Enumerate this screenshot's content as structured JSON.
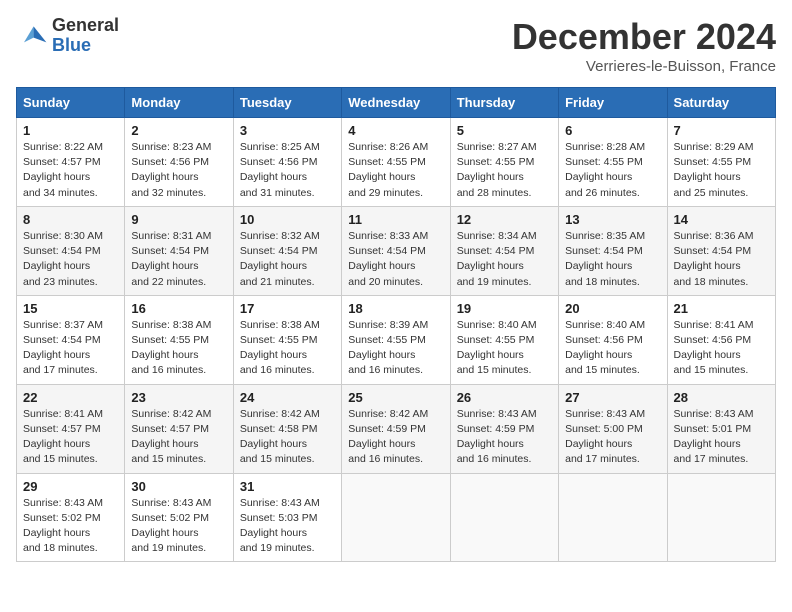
{
  "logo": {
    "general": "General",
    "blue": "Blue"
  },
  "header": {
    "month": "December 2024",
    "location": "Verrieres-le-Buisson, France"
  },
  "weekdays": [
    "Sunday",
    "Monday",
    "Tuesday",
    "Wednesday",
    "Thursday",
    "Friday",
    "Saturday"
  ],
  "weeks": [
    [
      {
        "day": "1",
        "sunrise": "8:22 AM",
        "sunset": "4:57 PM",
        "daylight": "8 hours and 34 minutes."
      },
      {
        "day": "2",
        "sunrise": "8:23 AM",
        "sunset": "4:56 PM",
        "daylight": "8 hours and 32 minutes."
      },
      {
        "day": "3",
        "sunrise": "8:25 AM",
        "sunset": "4:56 PM",
        "daylight": "8 hours and 31 minutes."
      },
      {
        "day": "4",
        "sunrise": "8:26 AM",
        "sunset": "4:55 PM",
        "daylight": "8 hours and 29 minutes."
      },
      {
        "day": "5",
        "sunrise": "8:27 AM",
        "sunset": "4:55 PM",
        "daylight": "8 hours and 28 minutes."
      },
      {
        "day": "6",
        "sunrise": "8:28 AM",
        "sunset": "4:55 PM",
        "daylight": "8 hours and 26 minutes."
      },
      {
        "day": "7",
        "sunrise": "8:29 AM",
        "sunset": "4:55 PM",
        "daylight": "8 hours and 25 minutes."
      }
    ],
    [
      {
        "day": "8",
        "sunrise": "8:30 AM",
        "sunset": "4:54 PM",
        "daylight": "8 hours and 23 minutes."
      },
      {
        "day": "9",
        "sunrise": "8:31 AM",
        "sunset": "4:54 PM",
        "daylight": "8 hours and 22 minutes."
      },
      {
        "day": "10",
        "sunrise": "8:32 AM",
        "sunset": "4:54 PM",
        "daylight": "8 hours and 21 minutes."
      },
      {
        "day": "11",
        "sunrise": "8:33 AM",
        "sunset": "4:54 PM",
        "daylight": "8 hours and 20 minutes."
      },
      {
        "day": "12",
        "sunrise": "8:34 AM",
        "sunset": "4:54 PM",
        "daylight": "8 hours and 19 minutes."
      },
      {
        "day": "13",
        "sunrise": "8:35 AM",
        "sunset": "4:54 PM",
        "daylight": "8 hours and 18 minutes."
      },
      {
        "day": "14",
        "sunrise": "8:36 AM",
        "sunset": "4:54 PM",
        "daylight": "8 hours and 18 minutes."
      }
    ],
    [
      {
        "day": "15",
        "sunrise": "8:37 AM",
        "sunset": "4:54 PM",
        "daylight": "8 hours and 17 minutes."
      },
      {
        "day": "16",
        "sunrise": "8:38 AM",
        "sunset": "4:55 PM",
        "daylight": "8 hours and 16 minutes."
      },
      {
        "day": "17",
        "sunrise": "8:38 AM",
        "sunset": "4:55 PM",
        "daylight": "8 hours and 16 minutes."
      },
      {
        "day": "18",
        "sunrise": "8:39 AM",
        "sunset": "4:55 PM",
        "daylight": "8 hours and 16 minutes."
      },
      {
        "day": "19",
        "sunrise": "8:40 AM",
        "sunset": "4:55 PM",
        "daylight": "8 hours and 15 minutes."
      },
      {
        "day": "20",
        "sunrise": "8:40 AM",
        "sunset": "4:56 PM",
        "daylight": "8 hours and 15 minutes."
      },
      {
        "day": "21",
        "sunrise": "8:41 AM",
        "sunset": "4:56 PM",
        "daylight": "8 hours and 15 minutes."
      }
    ],
    [
      {
        "day": "22",
        "sunrise": "8:41 AM",
        "sunset": "4:57 PM",
        "daylight": "8 hours and 15 minutes."
      },
      {
        "day": "23",
        "sunrise": "8:42 AM",
        "sunset": "4:57 PM",
        "daylight": "8 hours and 15 minutes."
      },
      {
        "day": "24",
        "sunrise": "8:42 AM",
        "sunset": "4:58 PM",
        "daylight": "8 hours and 15 minutes."
      },
      {
        "day": "25",
        "sunrise": "8:42 AM",
        "sunset": "4:59 PM",
        "daylight": "8 hours and 16 minutes."
      },
      {
        "day": "26",
        "sunrise": "8:43 AM",
        "sunset": "4:59 PM",
        "daylight": "8 hours and 16 minutes."
      },
      {
        "day": "27",
        "sunrise": "8:43 AM",
        "sunset": "5:00 PM",
        "daylight": "8 hours and 17 minutes."
      },
      {
        "day": "28",
        "sunrise": "8:43 AM",
        "sunset": "5:01 PM",
        "daylight": "8 hours and 17 minutes."
      }
    ],
    [
      {
        "day": "29",
        "sunrise": "8:43 AM",
        "sunset": "5:02 PM",
        "daylight": "8 hours and 18 minutes."
      },
      {
        "day": "30",
        "sunrise": "8:43 AM",
        "sunset": "5:02 PM",
        "daylight": "8 hours and 19 minutes."
      },
      {
        "day": "31",
        "sunrise": "8:43 AM",
        "sunset": "5:03 PM",
        "daylight": "8 hours and 19 minutes."
      },
      null,
      null,
      null,
      null
    ]
  ]
}
